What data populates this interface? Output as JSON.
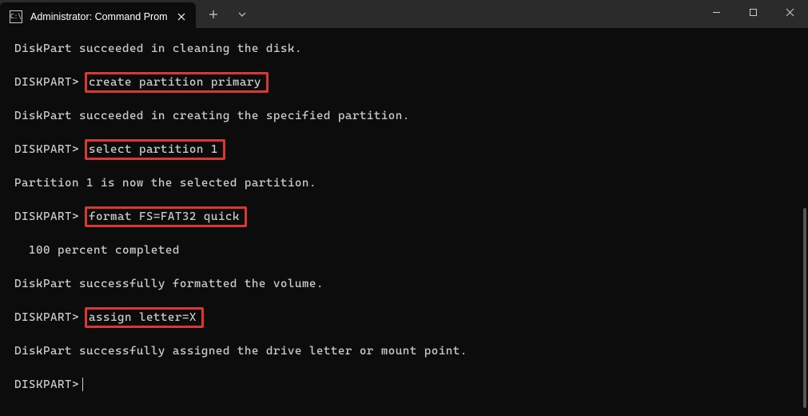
{
  "titlebar": {
    "tab_title": "Administrator: Command Promp",
    "tab_icon_label": "C:\\"
  },
  "terminal": {
    "lines": [
      {
        "type": "output",
        "text": "DiskPart succeeded in cleaning the disk."
      },
      {
        "type": "prompt",
        "prompt": "DISKPART>",
        "command": "create partition primary",
        "highlighted": true
      },
      {
        "type": "output",
        "text": "DiskPart succeeded in creating the specified partition."
      },
      {
        "type": "prompt",
        "prompt": "DISKPART>",
        "command": "select partition 1",
        "highlighted": true
      },
      {
        "type": "output",
        "text": "Partition 1 is now the selected partition."
      },
      {
        "type": "prompt",
        "prompt": "DISKPART>",
        "command": "format FS=FAT32 quick",
        "highlighted": true
      },
      {
        "type": "output_indent",
        "text": "100 percent completed"
      },
      {
        "type": "output",
        "text": "DiskPart successfully formatted the volume."
      },
      {
        "type": "prompt",
        "prompt": "DISKPART>",
        "command": "assign letter=X",
        "highlighted": true
      },
      {
        "type": "output",
        "text": "DiskPart successfully assigned the drive letter or mount point."
      },
      {
        "type": "prompt_cursor",
        "prompt": "DISKPART>"
      }
    ]
  }
}
